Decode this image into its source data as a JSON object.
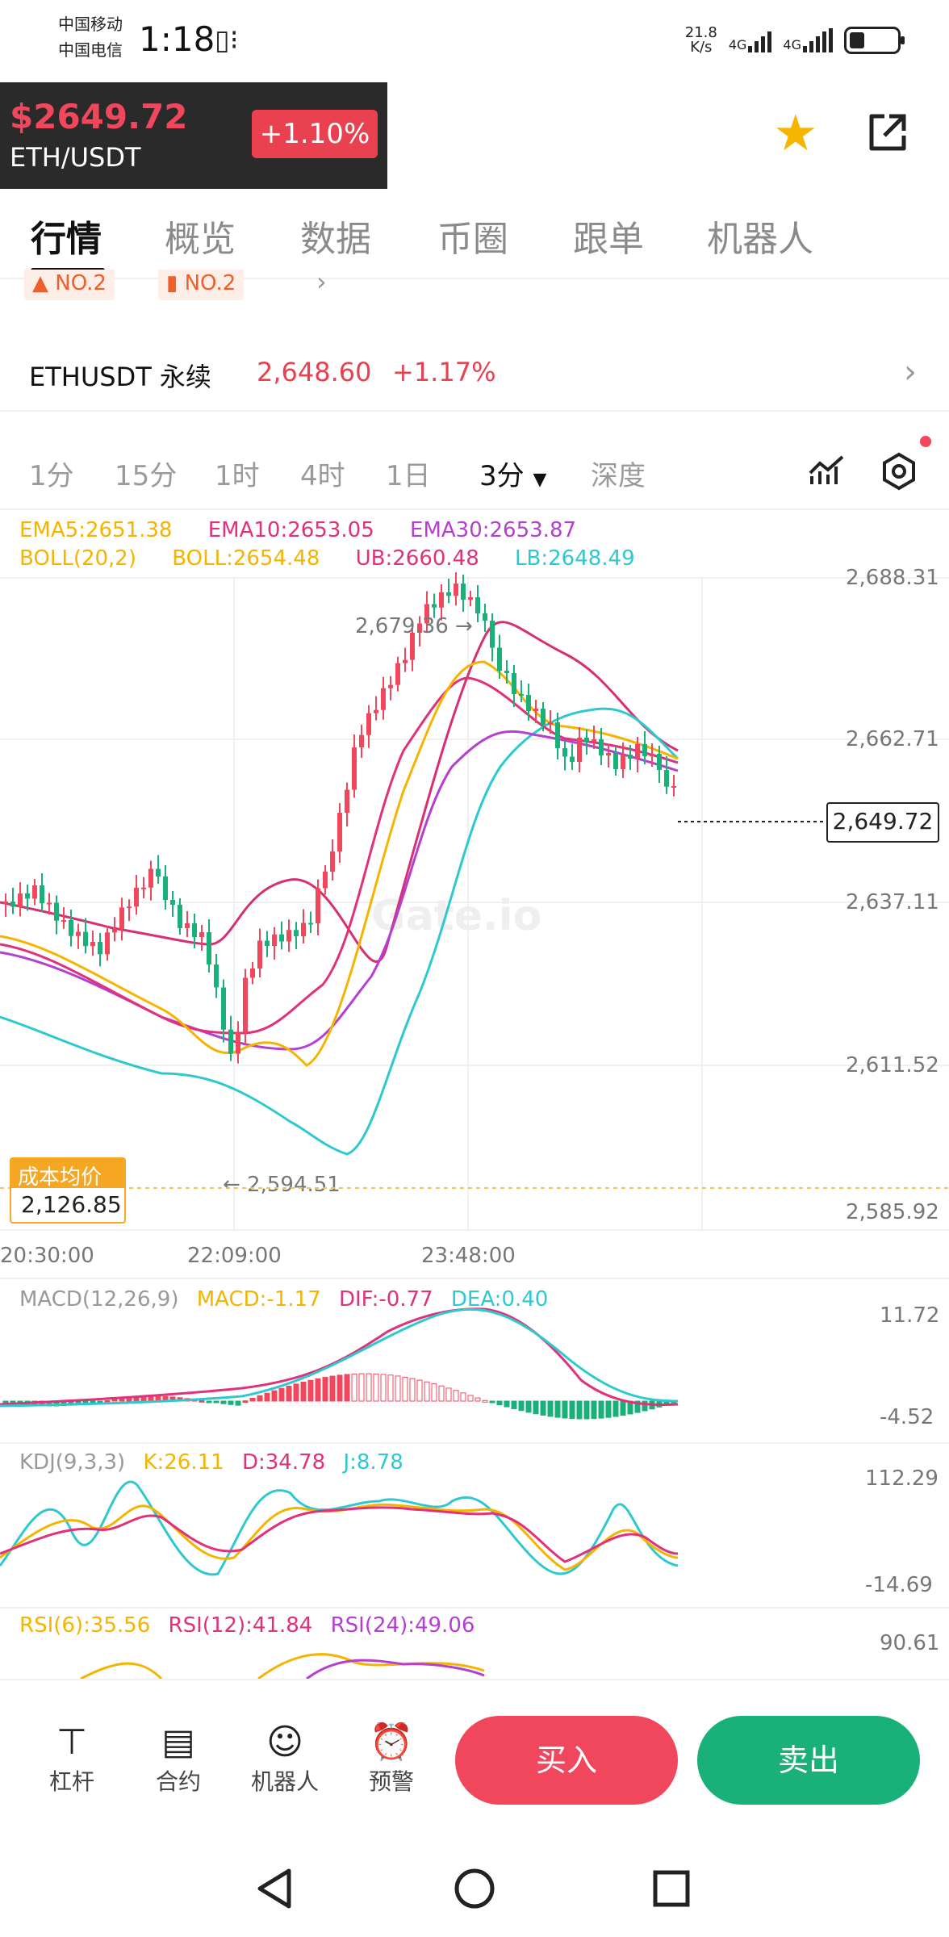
{
  "status_bar": {
    "carrier1": "中国移动",
    "carrier2": "中国电信",
    "time": "1:18",
    "net_speed": "21.8",
    "net_unit": "K/s",
    "net1": "4G",
    "net2": "4G"
  },
  "header": {
    "price": "$2649.72",
    "pair": "ETH/USDT",
    "change": "+1.10%",
    "star_color": "#f7b500"
  },
  "tabs": [
    "行情",
    "概览",
    "数据",
    "币圈",
    "跟单",
    "机器人"
  ],
  "ranks": [
    "NO.2",
    "NO.2"
  ],
  "contract": {
    "name": "ETHUSDT 永续",
    "price": "2,648.60",
    "change": "+1.17%"
  },
  "intervals": [
    "1分",
    "15分",
    "1时",
    "4时",
    "1日",
    "3分",
    "深度"
  ],
  "indicators": {
    "ema5": "EMA5:2651.38",
    "ema10": "EMA10:2653.05",
    "ema30": "EMA30:2653.87",
    "boll": "BOLL(20,2)",
    "boll_mid": "BOLL:2654.48",
    "ub": "UB:2660.48",
    "lb": "LB:2648.49"
  },
  "main_chart": {
    "y_ticks": [
      "2,688.31",
      "2,662.71",
      "2,637.11",
      "2,611.52",
      "2,585.92"
    ],
    "x_ticks": [
      "20:30:00",
      "22:09:00",
      "23:48:00"
    ],
    "high_label": "2,679.36 →",
    "low_label": "← 2,594.51",
    "current_price": "2,649.72",
    "cost_title": "成本均价",
    "cost_value": "2,126.85",
    "watermark": "Gate.io"
  },
  "macd": {
    "title": "MACD(12,26,9)",
    "macd": "MACD:-1.17",
    "dif": "DIF:-0.77",
    "dea": "DEA:0.40",
    "y_ticks": [
      "11.72",
      "-4.52"
    ]
  },
  "kdj": {
    "title": "KDJ(9,3,3)",
    "k": "K:26.11",
    "d": "D:34.78",
    "j": "J:8.78",
    "y_ticks": [
      "112.29",
      "-14.69"
    ]
  },
  "rsi": {
    "r6": "RSI(6):35.56",
    "r12": "RSI(12):41.84",
    "r24": "RSI(24):49.06",
    "y_tick": "90.61"
  },
  "bottom_bar": {
    "items": [
      "杠杆",
      "合约",
      "机器人",
      "预警"
    ],
    "buy": "买入",
    "sell": "卖出"
  },
  "colors": {
    "up": "#f0475d",
    "down": "#1ab07a",
    "ema5": "#f5b400",
    "ema10": "#e0317a",
    "ema30": "#b43fd0",
    "ub": "#d62f73",
    "lb": "#2ec9cf"
  }
}
